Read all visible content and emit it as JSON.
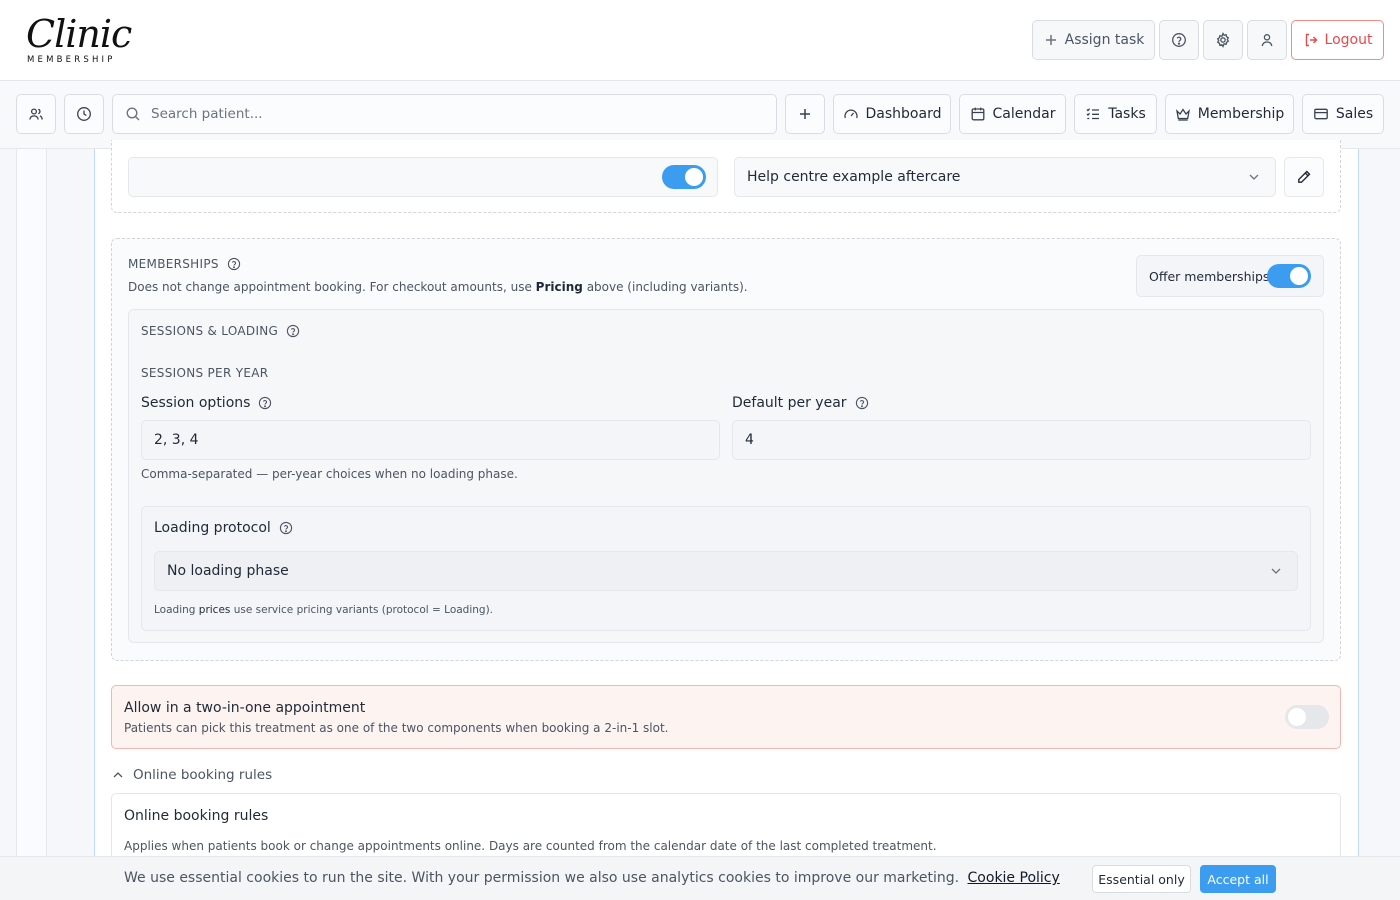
{
  "logo": {
    "script": "Clinic",
    "sub": "MEMBERSHIP"
  },
  "header": {
    "assign_task": "Assign task",
    "logout": "Logout"
  },
  "nav": {
    "search_placeholder": "Search patient...",
    "dashboard": "Dashboard",
    "calendar": "Calendar",
    "tasks": "Tasks",
    "membership": "Membership",
    "sales": "Sales"
  },
  "aftercare": {
    "enabled": true,
    "selected": "Help centre example aftercare"
  },
  "memberships": {
    "title": "MEMBERSHIPS",
    "desc_before": "Does not change appointment booking. For checkout amounts, use",
    "desc_bold": "Pricing",
    "desc_after": "above (including variants).",
    "offer_label": "Offer memberships",
    "offer_enabled": true,
    "sessions_loading_title": "SESSIONS & LOADING",
    "sessions_per_year_title": "SESSIONS PER YEAR",
    "session_options_label": "Session options",
    "session_options_value": "2, 3, 4",
    "default_per_year_label": "Default per year",
    "default_per_year_value": "4",
    "session_options_hint": "Comma-separated — per-year choices when no loading phase.",
    "loading_protocol_label": "Loading protocol",
    "loading_protocol_value": "No loading phase",
    "loading_note_prefix": "Loading",
    "loading_note_bold": "prices",
    "loading_note_rest": "use service pricing variants (protocol = Loading)."
  },
  "two_in_one": {
    "title": "Allow in a two-in-one appointment",
    "desc": "Patients can pick this treatment as one of the two components when booking a 2-in-1 slot.",
    "enabled": false
  },
  "online_booking": {
    "collapse_label": "Online booking rules",
    "title": "Online booking rules",
    "desc": "Applies when patients book or change appointments online. Days are counted from the calendar date of the last completed treatment."
  },
  "cookie": {
    "message": "We use essential cookies to run the site. With your permission we also use analytics cookies to improve our marketing.",
    "policy_link": "Cookie Policy",
    "essential_only": "Essential only",
    "accept_all": "Accept all"
  },
  "colors": {
    "accent": "#3b9cf0",
    "danger": "#e5484d",
    "two_in_one_bg": "#fdf3f1"
  }
}
